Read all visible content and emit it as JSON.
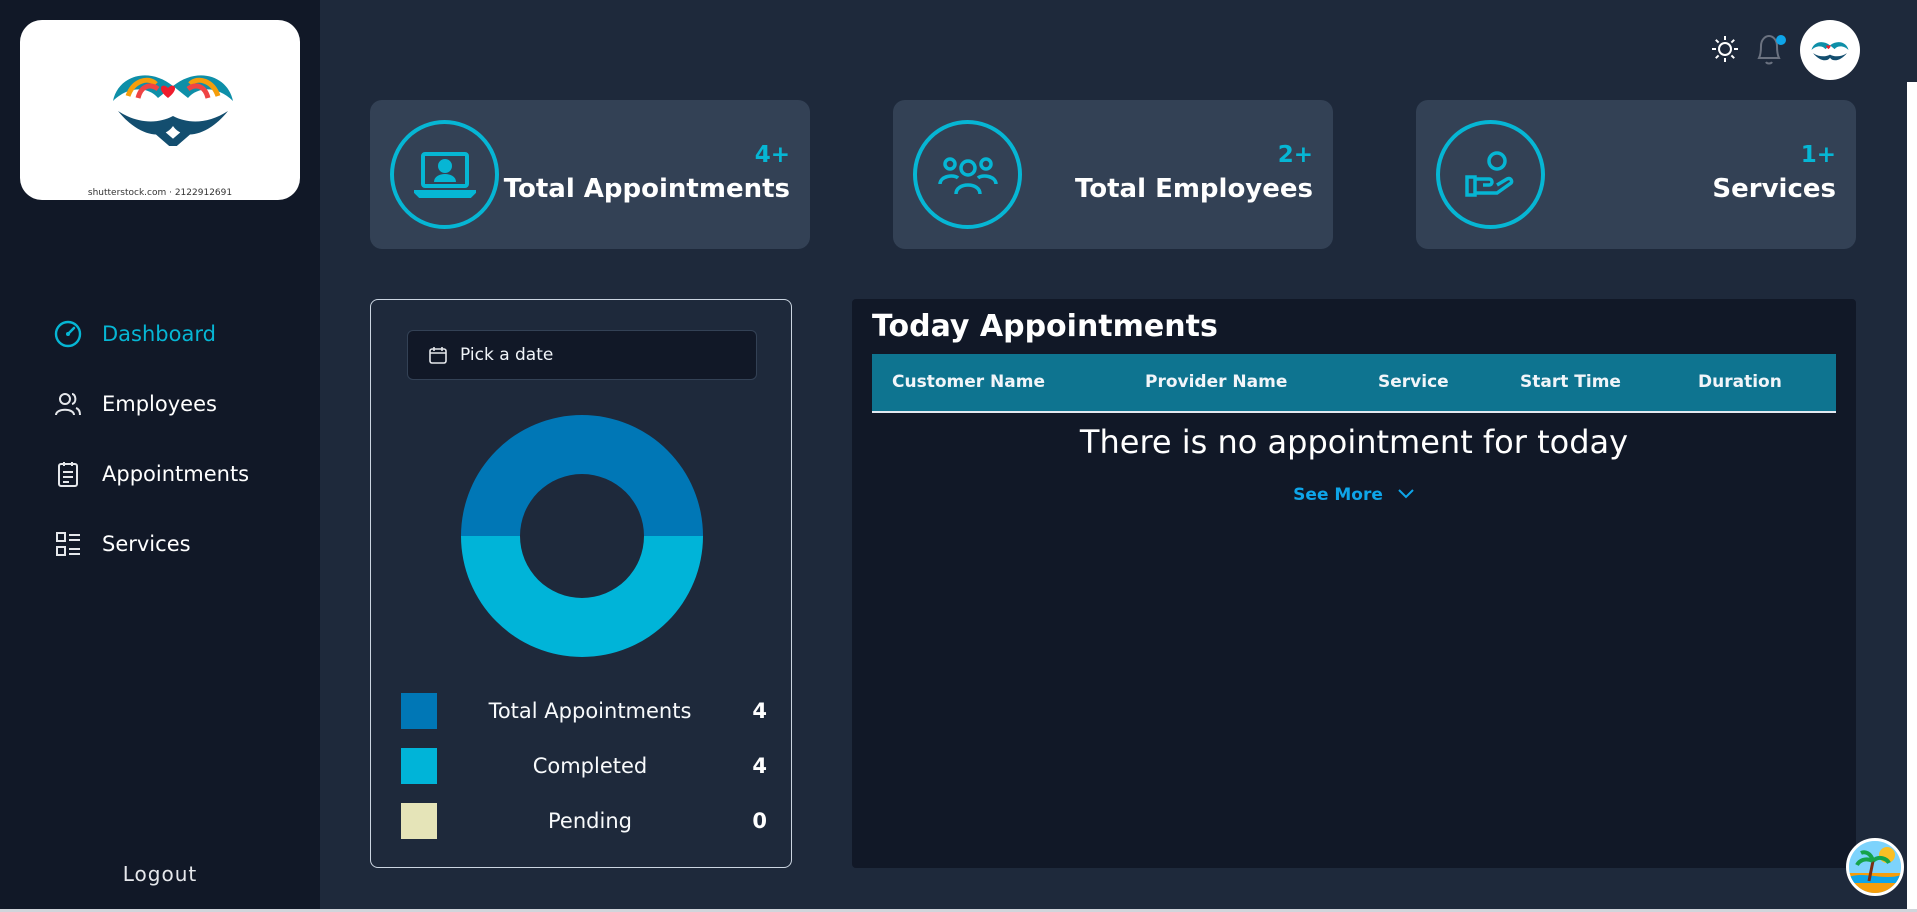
{
  "sidebar": {
    "logo_caption": "shutterstock.com · 2122912691",
    "items": [
      {
        "label": "Dashboard",
        "icon": "gauge-icon",
        "active": true
      },
      {
        "label": "Employees",
        "icon": "users-icon"
      },
      {
        "label": "Appointments",
        "icon": "clipboard-icon"
      },
      {
        "label": "Services",
        "icon": "list-grid-icon"
      }
    ],
    "logout_label": "Logout"
  },
  "topbar": {
    "theme_icon": "sun-icon",
    "notification_icon": "bell-icon"
  },
  "stats": [
    {
      "count": "4+",
      "label": "Total Appointments",
      "icon": "laptop-user-icon"
    },
    {
      "count": "2+",
      "label": "Total Employees",
      "icon": "group-icon"
    },
    {
      "count": "1+",
      "label": "Services",
      "icon": "hand-user-icon"
    }
  ],
  "chart_panel": {
    "date_placeholder": "Pick a date"
  },
  "chart_data": {
    "type": "pie",
    "categories": [
      "Total Appointments",
      "Completed",
      "Pending"
    ],
    "values": [
      4,
      4,
      0
    ],
    "colors": [
      "#0077b6",
      "#00b4d8",
      "#e5e4b8"
    ]
  },
  "appointments": {
    "title": "Today Appointments",
    "columns": [
      "Customer Name",
      "Provider Name",
      "Service",
      "Start Time",
      "Duration"
    ],
    "empty_message": "There is no appointment for today",
    "see_more_label": "See More"
  },
  "colors": {
    "accent": "#06b6d4",
    "sidebar_bg": "#111827",
    "page_bg": "#1e293b",
    "card_bg": "#334155",
    "table_header": "#0e7490"
  }
}
